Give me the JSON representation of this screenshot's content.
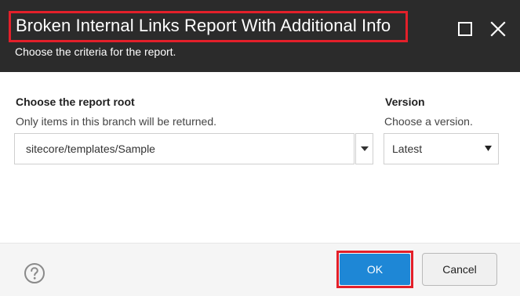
{
  "dialog": {
    "title": "Broken Internal Links Report With Additional Info",
    "subtitle": "Choose the criteria for the report."
  },
  "window_controls": {
    "maximize_icon": "maximize-icon",
    "close_icon": "close-icon"
  },
  "form": {
    "report_root": {
      "label": "Choose the report root",
      "description": "Only items in this branch will be returned.",
      "value": "sitecore/templates/Sample"
    },
    "version": {
      "label": "Version",
      "description": "Choose a version.",
      "selected": "Latest"
    }
  },
  "footer": {
    "help_icon": "help-icon",
    "ok_label": "OK",
    "cancel_label": "Cancel"
  },
  "colors": {
    "title_bar": "#2b2b2b",
    "highlight": "#e3202a",
    "primary_button": "#1e87d6"
  }
}
